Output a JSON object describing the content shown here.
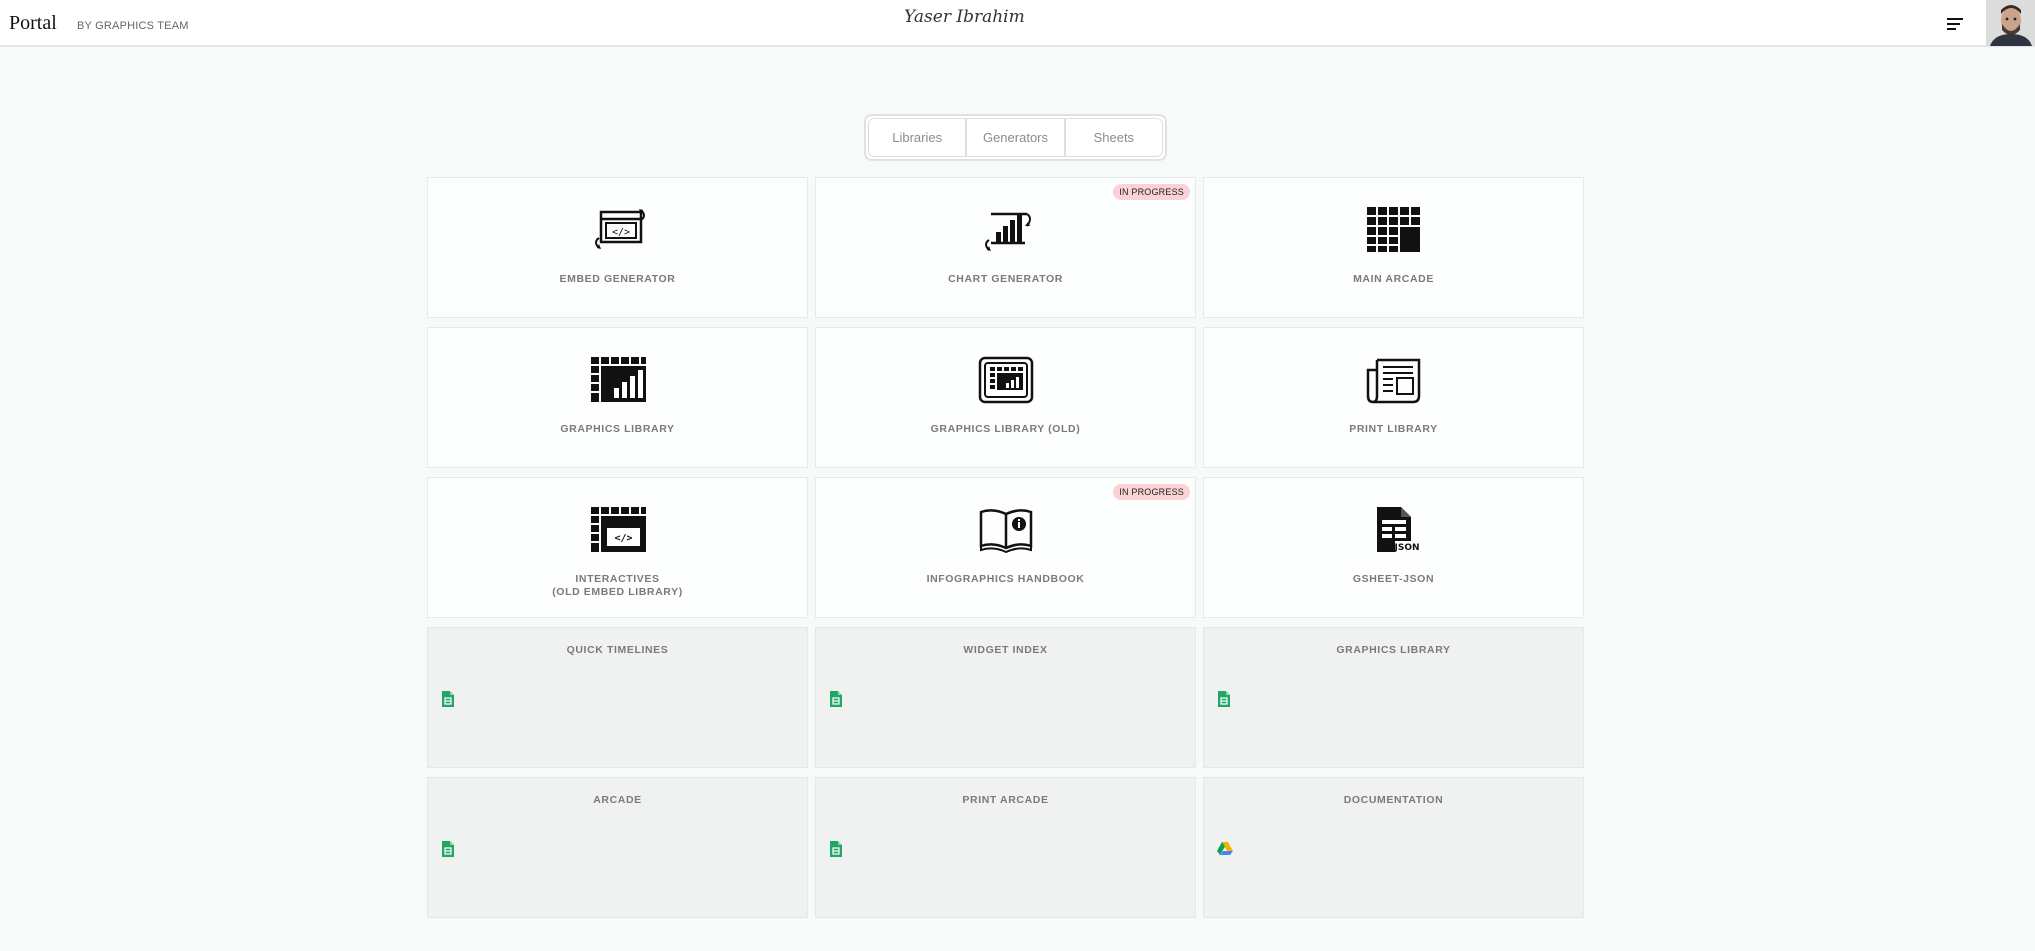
{
  "header": {
    "brand": "Portal",
    "brand_sub": "BY GRAPHICS TEAM",
    "signature": "Yaser Ibrahim"
  },
  "tabs": [
    {
      "label": "Libraries"
    },
    {
      "label": "Generators"
    },
    {
      "label": "Sheets"
    }
  ],
  "cards": [
    {
      "label": "EMBED GENERATOR",
      "icon": "embed-generator-icon"
    },
    {
      "label": "CHART GENERATOR",
      "icon": "chart-generator-icon",
      "badge": "IN PROGRESS"
    },
    {
      "label": "MAIN ARCADE",
      "icon": "arcade-grid-icon"
    },
    {
      "label": "GRAPHICS LIBRARY",
      "icon": "graphics-library-icon"
    },
    {
      "label": "GRAPHICS LIBRARY (OLD)",
      "icon": "graphics-library-old-icon"
    },
    {
      "label": "PRINT LIBRARY",
      "icon": "newspaper-icon"
    },
    {
      "label": "INTERACTIVES\n(OLD EMBED LIBRARY)",
      "icon": "interactives-icon"
    },
    {
      "label": "INFOGRAPHICS HANDBOOK",
      "icon": "handbook-icon",
      "badge": "IN PROGRESS"
    },
    {
      "label": "GSHEET-JSON",
      "icon": "json-file-icon"
    }
  ],
  "sheets": [
    {
      "label": "QUICK TIMELINES",
      "icon": "google-sheets-icon"
    },
    {
      "label": "WIDGET INDEX",
      "icon": "google-sheets-icon"
    },
    {
      "label": "GRAPHICS LIBRARY",
      "icon": "google-sheets-icon"
    },
    {
      "label": "ARCADE",
      "icon": "google-sheets-icon"
    },
    {
      "label": "PRINT ARCADE",
      "icon": "google-sheets-icon"
    },
    {
      "label": "DOCUMENTATION",
      "icon": "google-drive-icon"
    }
  ],
  "colors": {
    "badge_bg": "#fbd3d6",
    "sheets_green": "#23a566",
    "page_bg": "#f8f9f9"
  }
}
